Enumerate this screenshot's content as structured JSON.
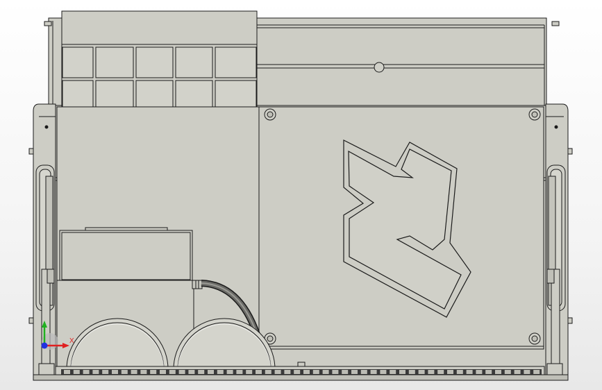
{
  "viewport": {
    "background_top": "#ffffff",
    "background_bottom": "#e8e8e8"
  },
  "model": {
    "face_color": "#cdcdc5",
    "face_light": "#d6d6ce",
    "edge_color": "#1a1a1a",
    "shadow_color": "#b9b9b1"
  },
  "triad": {
    "x_label": "X",
    "x_color": "#e02020",
    "y_color": "#20b020",
    "z_color": "#2030e0"
  },
  "icons": [
    "triad-icon"
  ]
}
